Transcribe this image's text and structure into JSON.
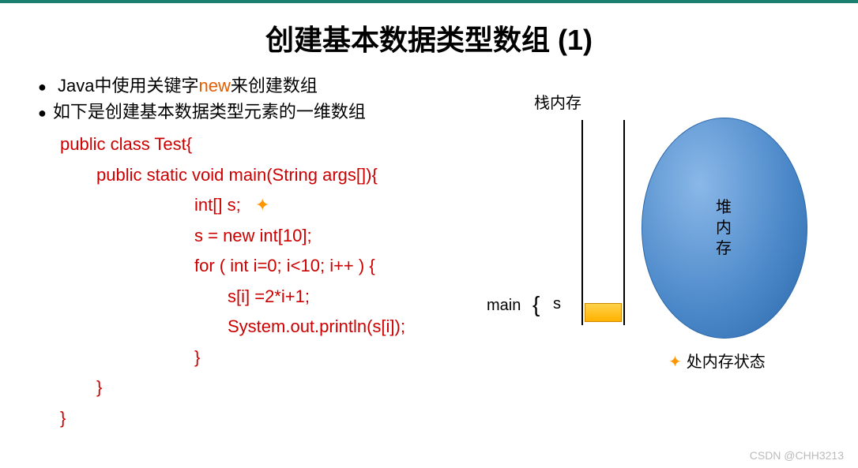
{
  "title": "创建基本数据类型数组 (1)",
  "bullets": {
    "b1_before": "Java中使用关键字",
    "b1_keyword": "new",
    "b1_after": "来创建数组",
    "b2": "如下是创建基本数据类型元素的一维数组"
  },
  "code": {
    "l1": "public class Test{",
    "l2": "public static void main(String args[]){",
    "l3a": "int[] s;",
    "l4": "s = new int[10];",
    "l5": "for ( int i=0; i<10; i++ ) {",
    "l6": "s[i] =2*i+1;",
    "l7": "System.out.println(s[i]);",
    "l8": "}",
    "l9": "}",
    "l10": "}"
  },
  "diagram": {
    "stack_label": "栈内存",
    "heap_label": "堆\n内\n存",
    "main_label": "main",
    "var_s": "s",
    "legend_text": "处内存状态"
  },
  "watermark": "CSDN @CHH3213"
}
